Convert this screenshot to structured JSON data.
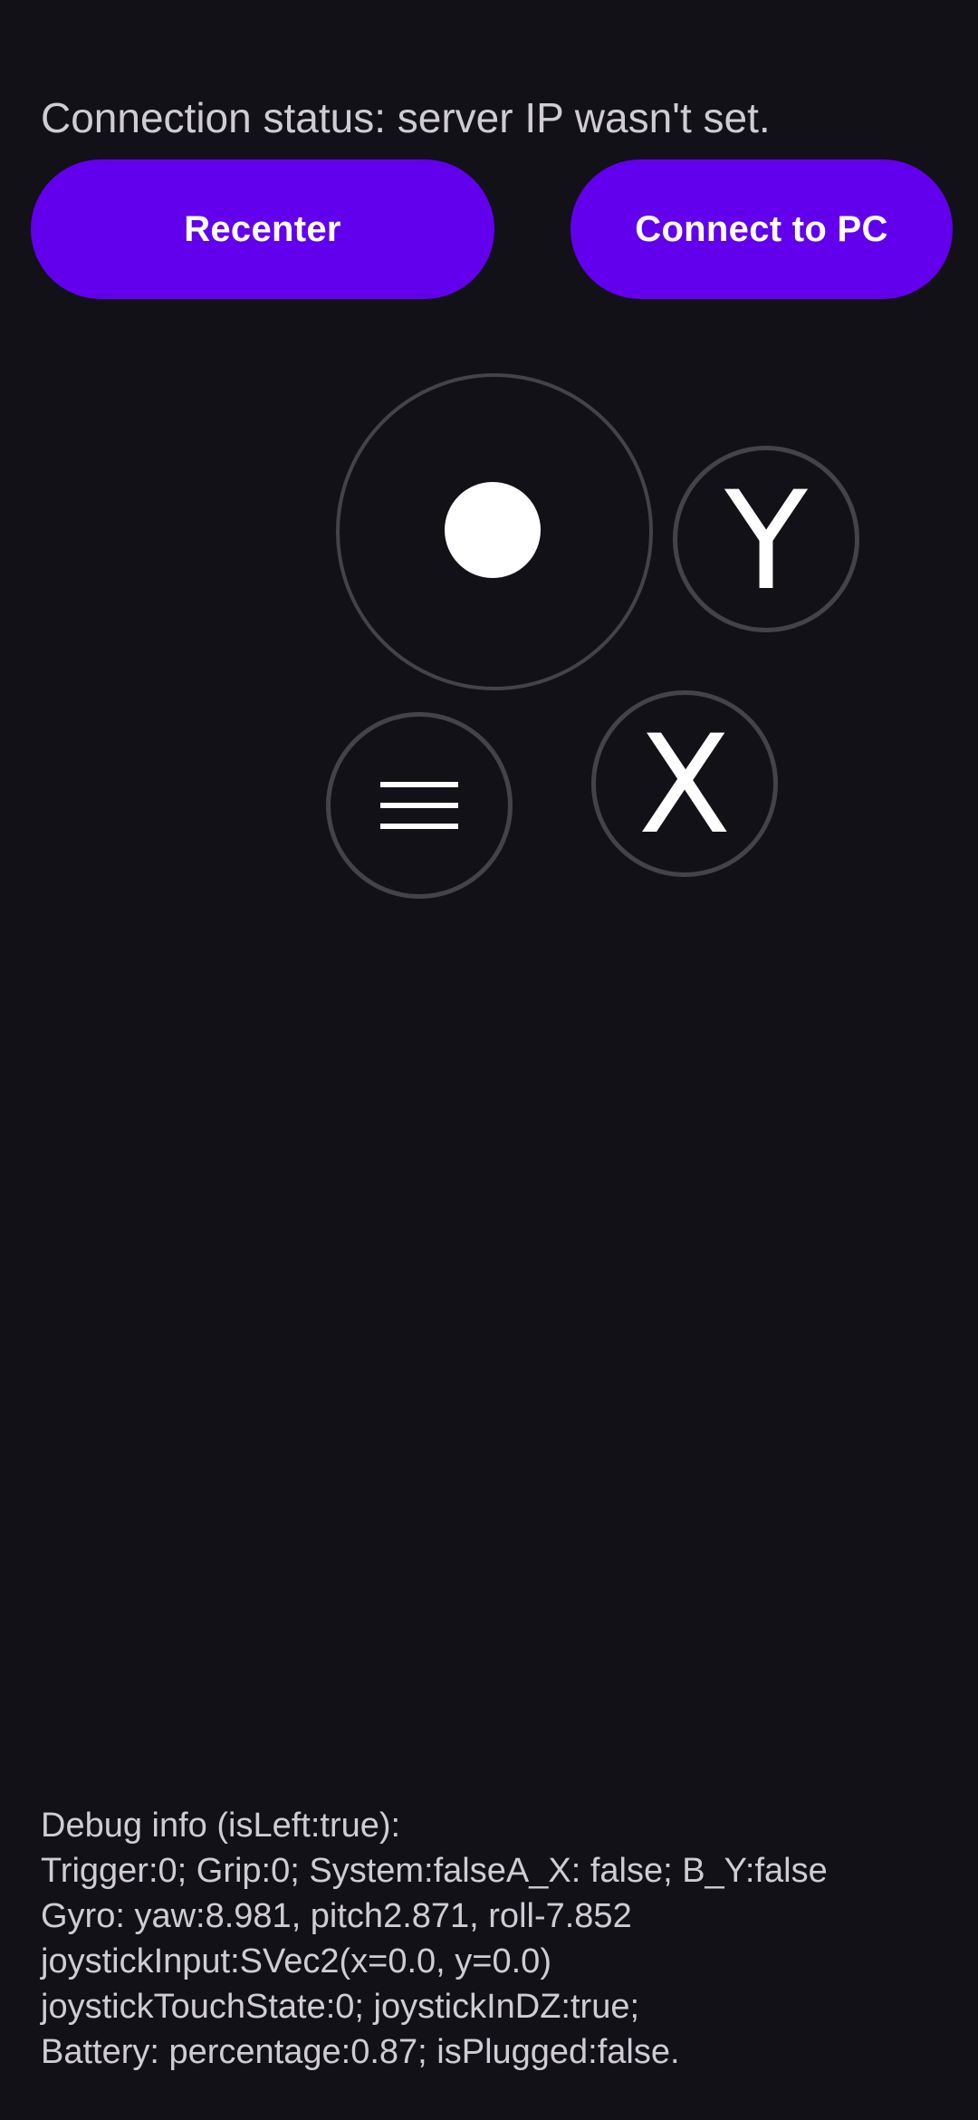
{
  "status": {
    "text": "Connection status: server IP wasn't set."
  },
  "buttons": {
    "recenter_label": "Recenter",
    "connect_label": "Connect to PC"
  },
  "controls": {
    "y_label": "Y",
    "x_label": "X",
    "menu_icon": "hamburger-menu-icon",
    "joystick_knob_position": {
      "x": 0.0,
      "y": 0.0
    }
  },
  "debug": {
    "lines": [
      "Debug info (isLeft:true):",
      "Trigger:0; Grip:0; System:falseA_X: false; B_Y:false",
      "Gyro: yaw:8.981, pitch2.871, roll-7.852",
      "joystickInput:SVec2(x=0.0, y=0.0)",
      "joystickTouchState:0; joystickInDZ:true;",
      "Battery: percentage:0.87; isPlugged:false."
    ]
  },
  "colors": {
    "background": "#131118",
    "accent": "#6200ee",
    "ring": "#454349",
    "text": "#cfcdd3"
  }
}
